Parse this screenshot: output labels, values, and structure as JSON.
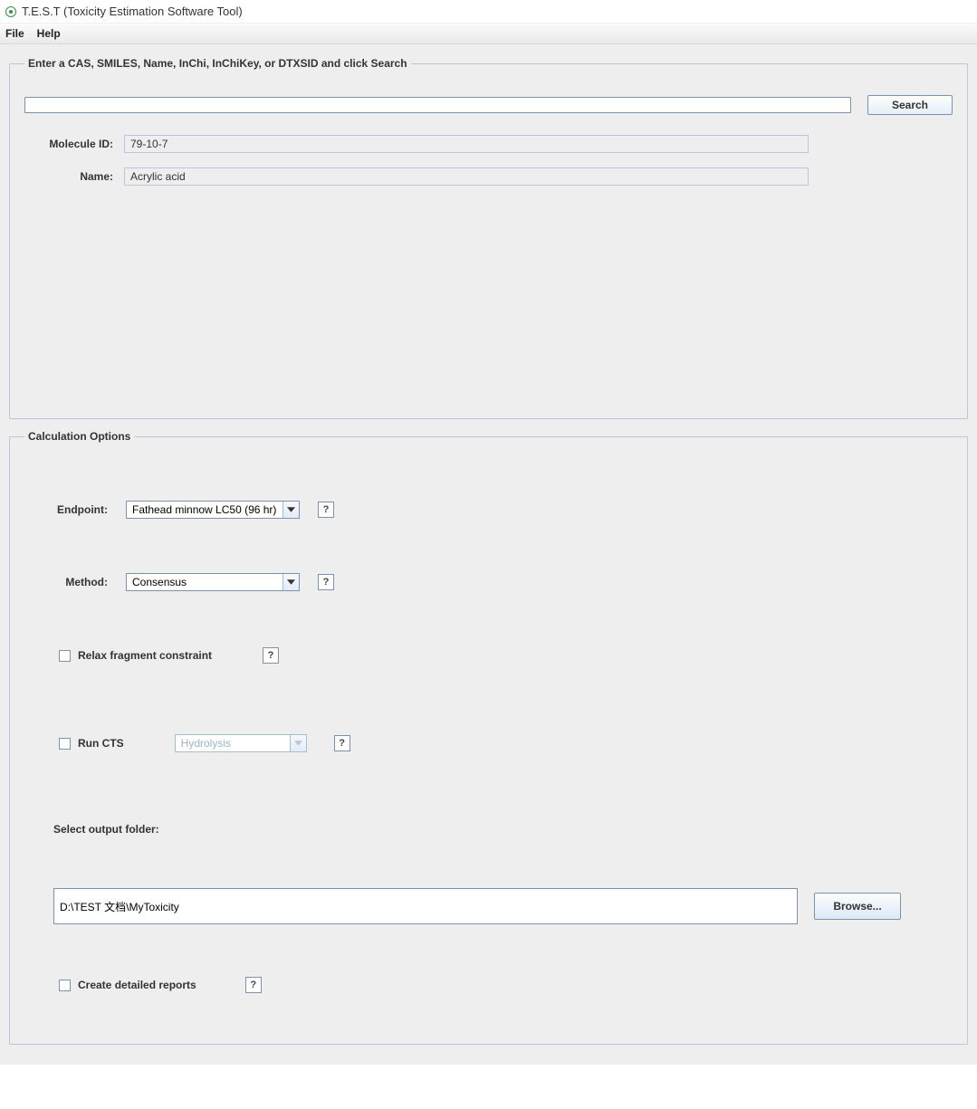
{
  "window": {
    "title": "T.E.S.T (Toxicity Estimation Software Tool)"
  },
  "menu": {
    "file": "File",
    "help": "Help"
  },
  "search": {
    "legend": "Enter a CAS, SMILES, Name, InChi, InChiKey, or DTXSID and click Search",
    "input_value": "",
    "button": "Search",
    "molecule_id_label": "Molecule ID:",
    "molecule_id_value": "79-10-7",
    "name_label": "Name:",
    "name_value": "Acrylic acid"
  },
  "calc": {
    "legend": "Calculation Options",
    "endpoint_label": "Endpoint:",
    "endpoint_value": "Fathead minnow LC50 (96 hr)",
    "method_label": "Method:",
    "method_value": "Consensus",
    "relax_label": "Relax fragment constraint",
    "run_cts_label": "Run CTS",
    "cts_value": "Hydrolysis",
    "output_label": "Select output folder:",
    "output_value": "D:\\TEST 文档\\MyToxicity",
    "browse": "Browse...",
    "detailed_label": "Create detailed reports",
    "help": "?"
  }
}
